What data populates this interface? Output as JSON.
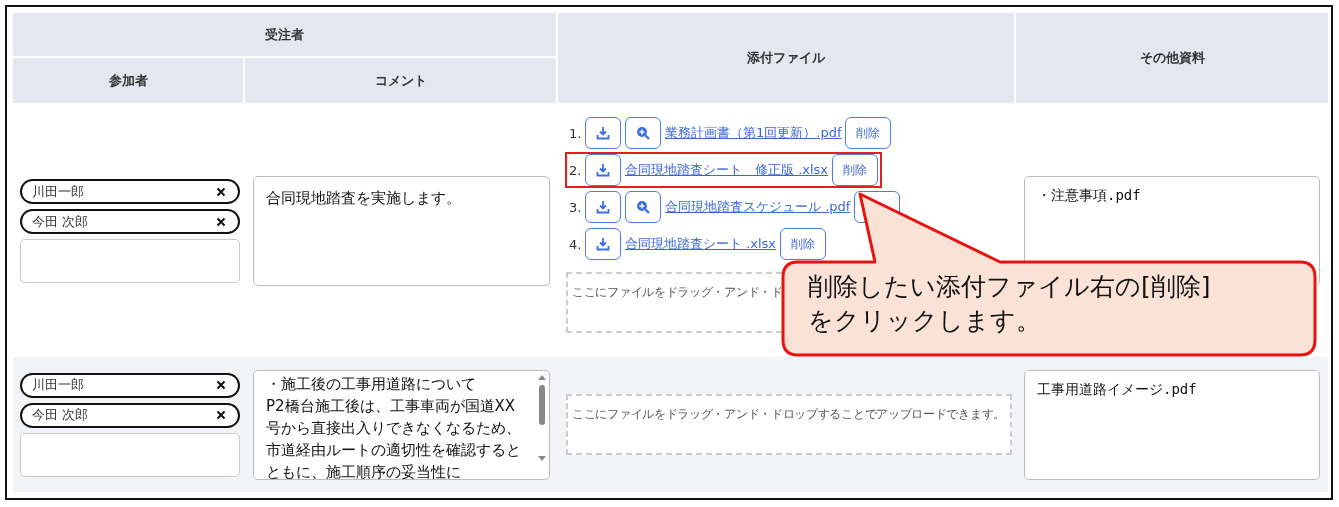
{
  "header": {
    "group": "受注者",
    "columns": [
      "参加者",
      "コメント",
      "添付ファイル",
      "その他資料"
    ]
  },
  "rows": [
    {
      "participants": [
        "川田一郎",
        "今田 次郎"
      ],
      "comment": [
        "合同現地踏査を実施します。"
      ],
      "scrollbar": false,
      "files": [
        {
          "number": "1.",
          "preview": true,
          "name": "業務計画書（第1回更新）.pdf",
          "delete": "削除",
          "highlighted": false
        },
        {
          "number": "2.",
          "preview": false,
          "name": "合同現地踏査シート　修正版 .xlsx",
          "delete": "削除",
          "highlighted": true
        },
        {
          "number": "3.",
          "preview": true,
          "name": "合同現地踏査スケジュール .pdf",
          "highlighted": false
        },
        {
          "number": "4.",
          "preview": false,
          "name": "合同現地踏査シート .xlsx",
          "delete": "削除",
          "highlighted": false
        }
      ],
      "dropzone": "ここにファイルをドラッグ・アンド・ド",
      "other": "・注意事項.pdf"
    },
    {
      "participants": [
        "川田一郎",
        "今田 次郎"
      ],
      "comment": [
        "・施工後の工事用道路について",
        "P2橋台施工後は、工事車両が国道XX号から直接出入りできなくなるため、市道経由ルートの適切性を確認するとともに、施工順序の妥当性に"
      ],
      "scrollbar": true,
      "files": [],
      "dropzone": "ここにファイルをドラッグ・アンド・ドロップすることでアップロードできます。",
      "other": "工事用道路イメージ.pdf"
    }
  ],
  "callout": {
    "lines": [
      "削除したい添付ファイル右の[削除]",
      "をクリックします。"
    ]
  }
}
